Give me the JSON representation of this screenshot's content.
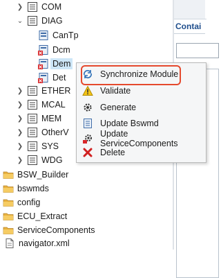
{
  "tree": {
    "items": [
      {
        "label": "COM",
        "icon": "module-list-icon"
      },
      {
        "label": "DIAG",
        "icon": "module-list-icon"
      },
      {
        "label": "CanTp",
        "icon": "config-module-icon"
      },
      {
        "label": "Dcm",
        "icon": "config-module-error-icon"
      },
      {
        "label": "Dem",
        "icon": "config-module-error-icon"
      },
      {
        "label": "Det",
        "icon": "config-module-error-icon"
      },
      {
        "label": "ETHER",
        "icon": "module-list-icon"
      },
      {
        "label": "MCAL",
        "icon": "module-list-icon"
      },
      {
        "label": "MEM",
        "icon": "module-list-icon"
      },
      {
        "label": "OtherV",
        "icon": "module-list-icon"
      },
      {
        "label": "SYS",
        "icon": "module-list-icon"
      },
      {
        "label": "WDG",
        "icon": "module-list-icon"
      },
      {
        "label": "BSW_Builder",
        "icon": "folder-icon"
      },
      {
        "label": "bswmds",
        "icon": "folder-icon"
      },
      {
        "label": "config",
        "icon": "folder-icon"
      },
      {
        "label": "ECU_Extract",
        "icon": "folder-icon"
      },
      {
        "label": "ServiceComponents",
        "icon": "folder-icon"
      },
      {
        "label": "navigator.xml",
        "icon": "xml-file-icon"
      }
    ]
  },
  "right_panel": {
    "tab_label": "Contai"
  },
  "context_menu": {
    "items": [
      {
        "label": "Synchronize Module",
        "icon": "sync-icon"
      },
      {
        "label": "Validate",
        "icon": "warning-icon"
      },
      {
        "label": "Generate",
        "icon": "generate-gear-icon"
      },
      {
        "label": "Update Bswmd",
        "icon": "document-icon"
      },
      {
        "label": "Update ServiceComponents",
        "icon": "service-gear-icon"
      },
      {
        "label": "Delete",
        "icon": "delete-icon"
      }
    ]
  },
  "colors": {
    "highlight_border": "#e5492d",
    "selection": "#cde6f7",
    "menu_bg": "#f5f6f7"
  }
}
